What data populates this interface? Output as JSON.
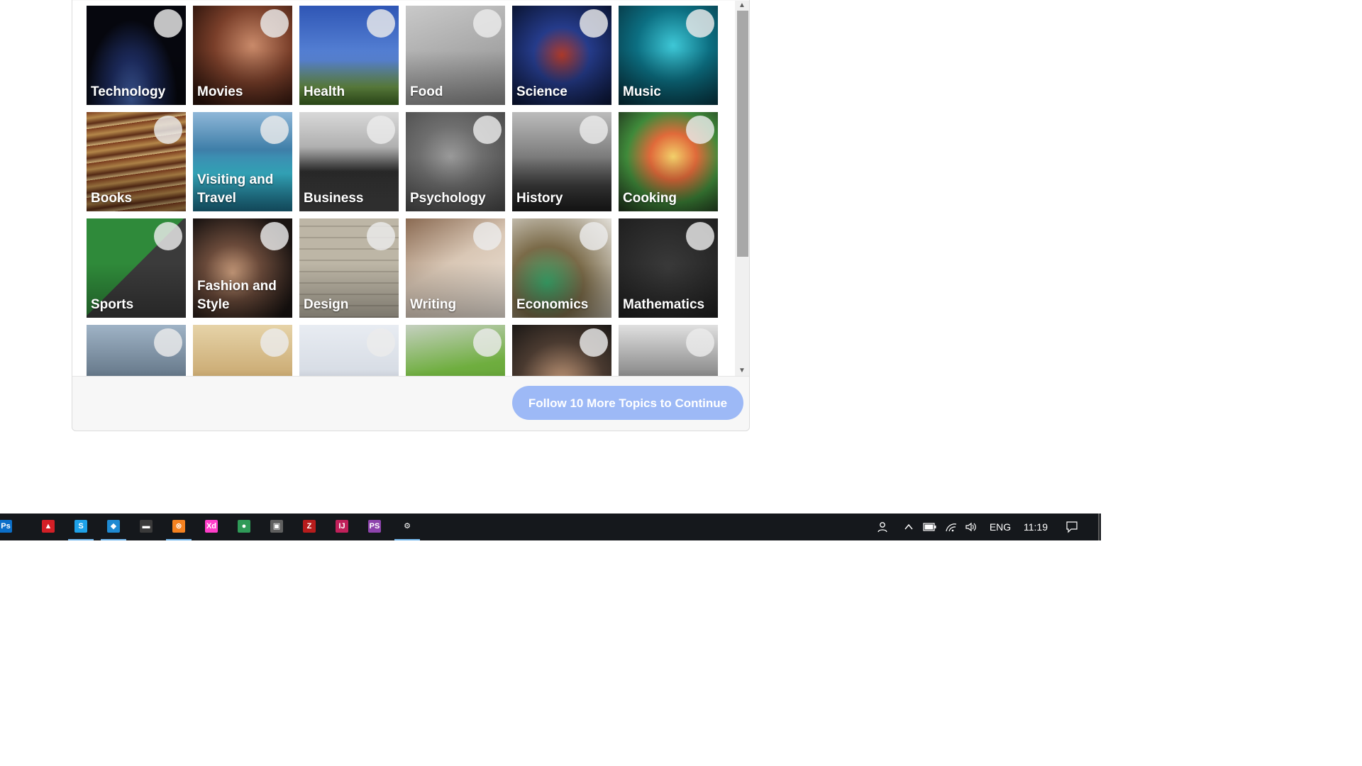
{
  "topics": [
    {
      "label": "Technology",
      "bg": "radial-gradient(ellipse at 45% 95%, #4a6cb8 0%, #1d2c60 30%, #06070e 60%)"
    },
    {
      "label": "Movies",
      "bg": "radial-gradient(circle at 60% 40%, #c98a6a 0%, #7a3f2a 45%, #2a120b 90%)"
    },
    {
      "label": "Health",
      "bg": "linear-gradient(180deg, #2f56b5 0%, #5a86d8 55%, #6f9b4a 82%, #3f6a24 100%)"
    },
    {
      "label": "Food",
      "bg": "linear-gradient(160deg, #c9c9c9 0%, #8a8a8a 100%)"
    },
    {
      "label": "Science",
      "bg": "radial-gradient(ellipse at 50% 50%, #b03a2a 0%, #253b8a 40%, #0a1432 100%)"
    },
    {
      "label": "Music",
      "bg": "radial-gradient(circle at 55% 40%, #3ec7d6 0%, #0c6f82 45%, #062a36 100%)"
    },
    {
      "label": "Books",
      "bg": "repeating-linear-gradient(172deg, #7a3a1c 0px, #b4874a 9px, #5d2d16 17px, #d2b37a 24px)"
    },
    {
      "label": "Visiting and Travel",
      "bg": "linear-gradient(180deg, #8fb7d8 0%, #3e7ea8 38%, #37b3c9 62%, #1c6d88 100%)"
    },
    {
      "label": "Business",
      "bg": "linear-gradient(180deg, #d8d8d8 0%, #b0b0b0 35%, #2b2b2b 60%, #474747 100%)"
    },
    {
      "label": "Psychology",
      "bg": "radial-gradient(circle at 45% 45%, #9a9a9a 0%, #6e6e6e 40%, #474747 100%)"
    },
    {
      "label": "History",
      "bg": "linear-gradient(180deg, #bcbcbc 0%, #7c7c7c 45%, #3a3a3a 75%, #1d1d1d 100%)"
    },
    {
      "label": "Cooking",
      "bg": "radial-gradient(circle at 55% 45%, #f2d06a 0%, #e06a3a 30%, #3f8a3a 60%, #20301c 100%)"
    },
    {
      "label": "Sports",
      "bg": "linear-gradient(135deg, #2f8a3a 0% 49%, #3b3b3b 49% 100%)"
    },
    {
      "label": "Fashion and Style",
      "bg": "radial-gradient(circle at 40% 55%, #c79a7a 0%, #6a4a3a 35%, #1a1412 80%)"
    },
    {
      "label": "Design",
      "bg": "repeating-linear-gradient(0deg, #a49d8e 0 2px, #bdb6a6 2px 16px)"
    },
    {
      "label": "Writing",
      "bg": "linear-gradient(150deg, #8a6a52 0%, #d9c7b5 45%, #efe6dc 100%)"
    },
    {
      "label": "Economics",
      "bg": "radial-gradient(circle at 35% 65%, #3aa66a 0%, #7a6a48 40%, #e3e0da 100%)"
    },
    {
      "label": "Mathematics",
      "bg": "radial-gradient(circle at 50% 50%, #3a3a3a 0%, #1f1f1f 100%)"
    },
    {
      "label": "",
      "bg": "linear-gradient(180deg, #9fb3c6 0%, #5d6f80 60%, #2f3a44 100%)"
    },
    {
      "label": "",
      "bg": "linear-gradient(180deg, #e6d3a8 0%, #c6a46a 60%, #8a6a34 100%)"
    },
    {
      "label": "",
      "bg": "linear-gradient(180deg, #e8ecf2 0%, #c4cbd6 100%)"
    },
    {
      "label": "",
      "bg": "linear-gradient(170deg, #c5d0c0 0%, #6fae3f 45%, #53922b 100%)"
    },
    {
      "label": "",
      "bg": "radial-gradient(circle at 50% 60%, #c59a7a 0%, #4a3a30 55%, #1b1816 100%)"
    },
    {
      "label": "",
      "bg": "linear-gradient(180deg, #e0e0e0 0%, #7a7a7a 60%, #2e2e2e 100%)"
    }
  ],
  "continue_button": "Follow 10 More Topics to Continue",
  "taskbar": {
    "apps": [
      {
        "name": "photoshop",
        "glyph": "Ps",
        "color": "#0b6fc9"
      },
      {
        "name": "acrobat-reader",
        "glyph": "▲",
        "color": "#d31f26"
      },
      {
        "name": "skype",
        "glyph": "S",
        "color": "#1ea1e8"
      },
      {
        "name": "vscode",
        "glyph": "◆",
        "color": "#1f8ad2"
      },
      {
        "name": "terminal",
        "glyph": "▬",
        "color": "#3a3a3a"
      },
      {
        "name": "xampp",
        "glyph": "⊗",
        "color": "#f58220"
      },
      {
        "name": "adobe-xd",
        "glyph": "Xd",
        "color": "#ff3ec9"
      },
      {
        "name": "gitkraken",
        "glyph": "●",
        "color": "#2f9a58"
      },
      {
        "name": "image-viewer",
        "glyph": "▣",
        "color": "#5f5f5f"
      },
      {
        "name": "filezilla",
        "glyph": "Z",
        "color": "#b71c1c"
      },
      {
        "name": "intellij",
        "glyph": "IJ",
        "color": "#c0205a"
      },
      {
        "name": "phpstorm",
        "glyph": "PS",
        "color": "#8e44ad"
      },
      {
        "name": "settings",
        "glyph": "⚙",
        "color": "#15181c"
      }
    ],
    "tray": {
      "language": "ENG",
      "time": "11:19"
    }
  }
}
